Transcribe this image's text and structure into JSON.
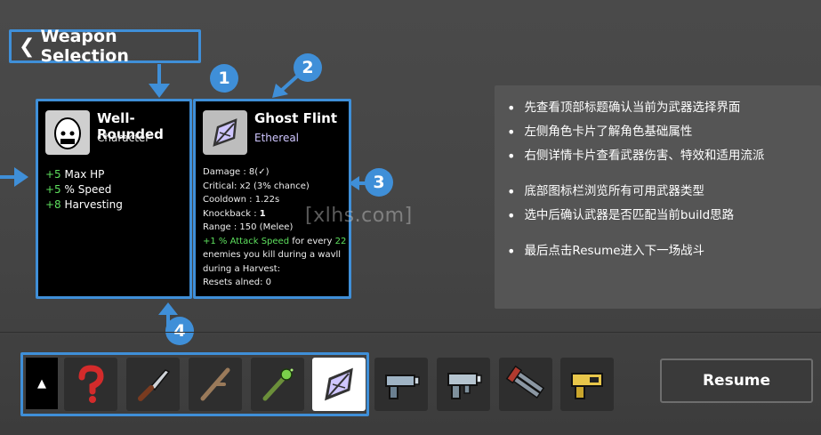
{
  "header": {
    "title": "Weapon Selection"
  },
  "character": {
    "name": "Well-Rounded",
    "type": "Character",
    "stats": [
      {
        "value": "+5",
        "label": "Max HP"
      },
      {
        "value": "+5",
        "label": "% Speed"
      },
      {
        "value": "+8",
        "label": "Harvesting"
      }
    ]
  },
  "weapon": {
    "name": "Ghost Flint",
    "type": "Ethereal",
    "damage": "Damage : 8(✓)",
    "critical": "Critical: x2 (3% chance)",
    "cooldown_label": "Cooldown : ",
    "cooldown": "1.22s",
    "knockback_label": "Knockback : ",
    "knockback": "1",
    "range": "Range : 150 (Melee)",
    "effect_value": "+1 % Attack Speed",
    "effect_text": " for every",
    "effect_count": "22",
    "effect_rest": " enemies you kill during a wavll during a Harvest:",
    "resets": "Resets alned: 0"
  },
  "badges": [
    "1",
    "2",
    "3",
    "4"
  ],
  "tips": [
    "先查看顶部标题确认当前为武器选择界面",
    "左侧角色卡片了解角色基础属性",
    "右侧详情卡片查看武器伤害、特效和适用流派",
    "底部图标栏浏览所有可用武器类型",
    "选中后确认武器是否匹配当前build思路",
    "最后点击Resume进入下一场战斗"
  ],
  "watermark": "[xlhs.com]",
  "weapon_slots": [
    {
      "icon": "question-mark-icon",
      "selected": false
    },
    {
      "icon": "knife-icon",
      "selected": false
    },
    {
      "icon": "stick-icon",
      "selected": false
    },
    {
      "icon": "green-wand-icon",
      "selected": false
    },
    {
      "icon": "ghost-flint-icon",
      "selected": true
    },
    {
      "icon": "pistol-icon",
      "selected": false
    },
    {
      "icon": "smg-icon",
      "selected": false
    },
    {
      "icon": "minigun-icon",
      "selected": false
    },
    {
      "icon": "taser-icon",
      "selected": false
    }
  ],
  "scroll_up_glyph": "▲",
  "resume_label": "Resume",
  "colors": {
    "highlight": "#3f8fd8",
    "green": "#5ee05e",
    "background": "#484848"
  }
}
